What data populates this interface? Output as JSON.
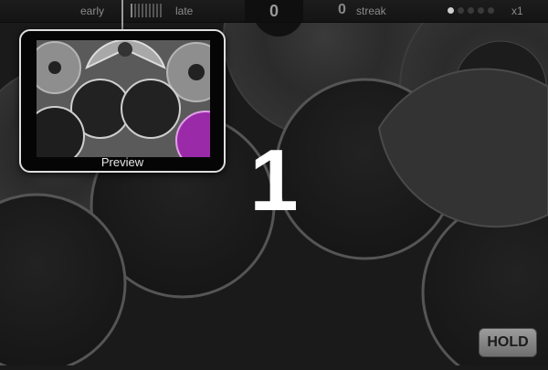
{
  "hud": {
    "early_label": "early",
    "late_label": "late",
    "score": "0",
    "streak_count": "0",
    "streak_label": "streak",
    "multiplier": "x1",
    "multiplier_dots_filled": 1,
    "multiplier_dots_total": 5
  },
  "preview": {
    "label": "Preview"
  },
  "countdown": "1",
  "hold_button": {
    "label": "HOLD"
  },
  "colors": {
    "background": "#1a1a1a",
    "pad_fill": "#1f1f1f",
    "pad_rim": "#555555",
    "highlight": "#9b2aa8"
  },
  "icons": {
    "cymbal": "cymbal-icon",
    "drum_pad": "drum-pad-icon"
  }
}
